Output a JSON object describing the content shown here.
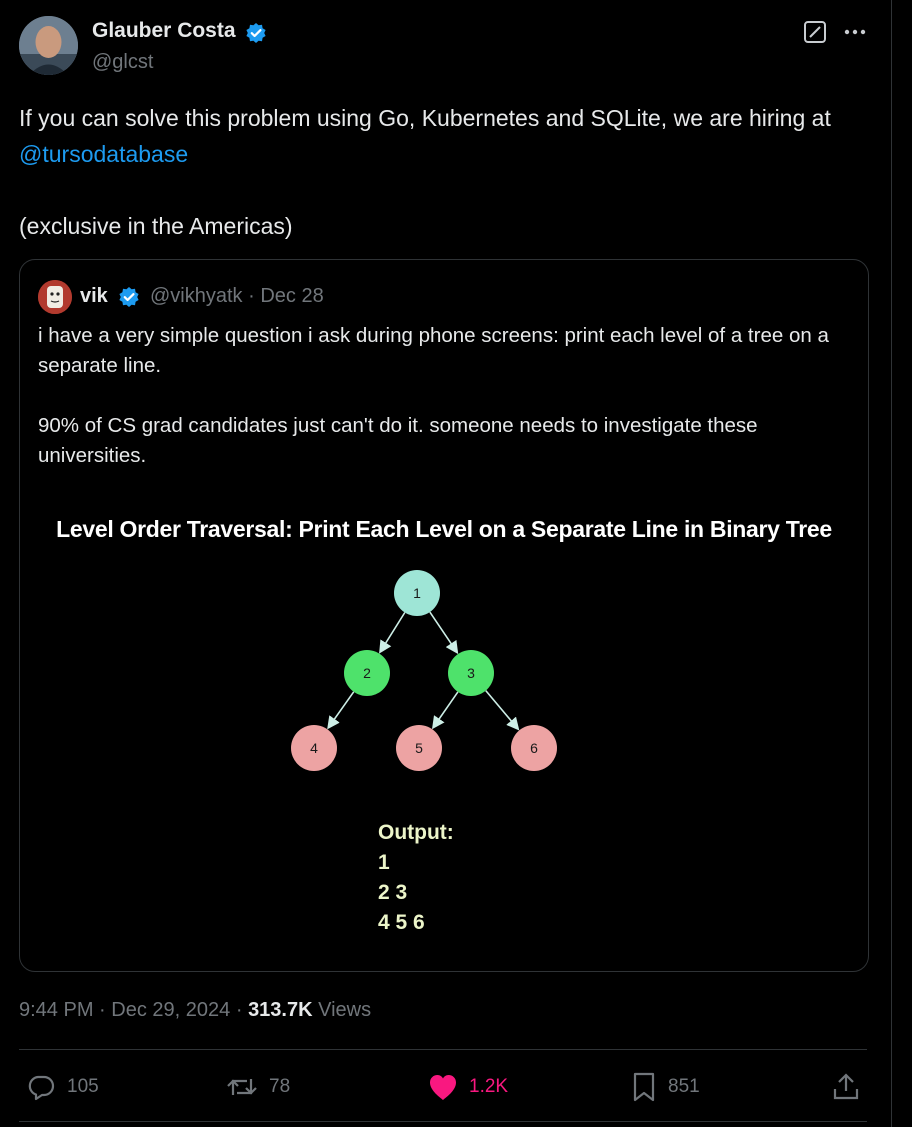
{
  "author": {
    "name": "Glauber Costa",
    "handle": "@glcst"
  },
  "tweet": {
    "text_before": "If you can solve this problem using Go, Kubernetes and SQLite, we are hiring at ",
    "mention": "@tursodatabase",
    "text_line2": "(exclusive in the Americas)"
  },
  "quote": {
    "name": "vik",
    "handle": "@vikhyatk",
    "separator": "·",
    "date": "Dec 28",
    "paragraph1": "i have a very simple question i ask during phone screens: print each level of a tree on a separate line.",
    "paragraph2": "90% of CS grad candidates just can't do it. someone needs to investigate these universities.",
    "image": {
      "title": "Level Order Traversal: Print Each Level on a Separate Line in Binary Tree",
      "nodes": [
        {
          "label": "1",
          "level": 0
        },
        {
          "label": "2",
          "level": 1
        },
        {
          "label": "3",
          "level": 1
        },
        {
          "label": "4",
          "level": 2
        },
        {
          "label": "5",
          "level": 2
        },
        {
          "label": "6",
          "level": 2
        }
      ],
      "colors": {
        "root": "#9ee5d6",
        "level1": "#4ee26b",
        "level2": "#eda3a3",
        "edge": "#cdeee6"
      },
      "output_label": "Output:",
      "output_lines": [
        "1",
        "2 3",
        "4 5 6"
      ]
    }
  },
  "meta": {
    "time": "9:44 PM",
    "dot": "·",
    "date": "Dec 29, 2024",
    "views_count": "313.7K",
    "views_label": "Views"
  },
  "actions": {
    "replies": "105",
    "reposts": "78",
    "likes": "1.2K",
    "bookmarks": "851"
  },
  "colors": {
    "background": "#000000",
    "accent": "#1d9bf0",
    "like": "#f91880",
    "muted": "#71767b"
  }
}
